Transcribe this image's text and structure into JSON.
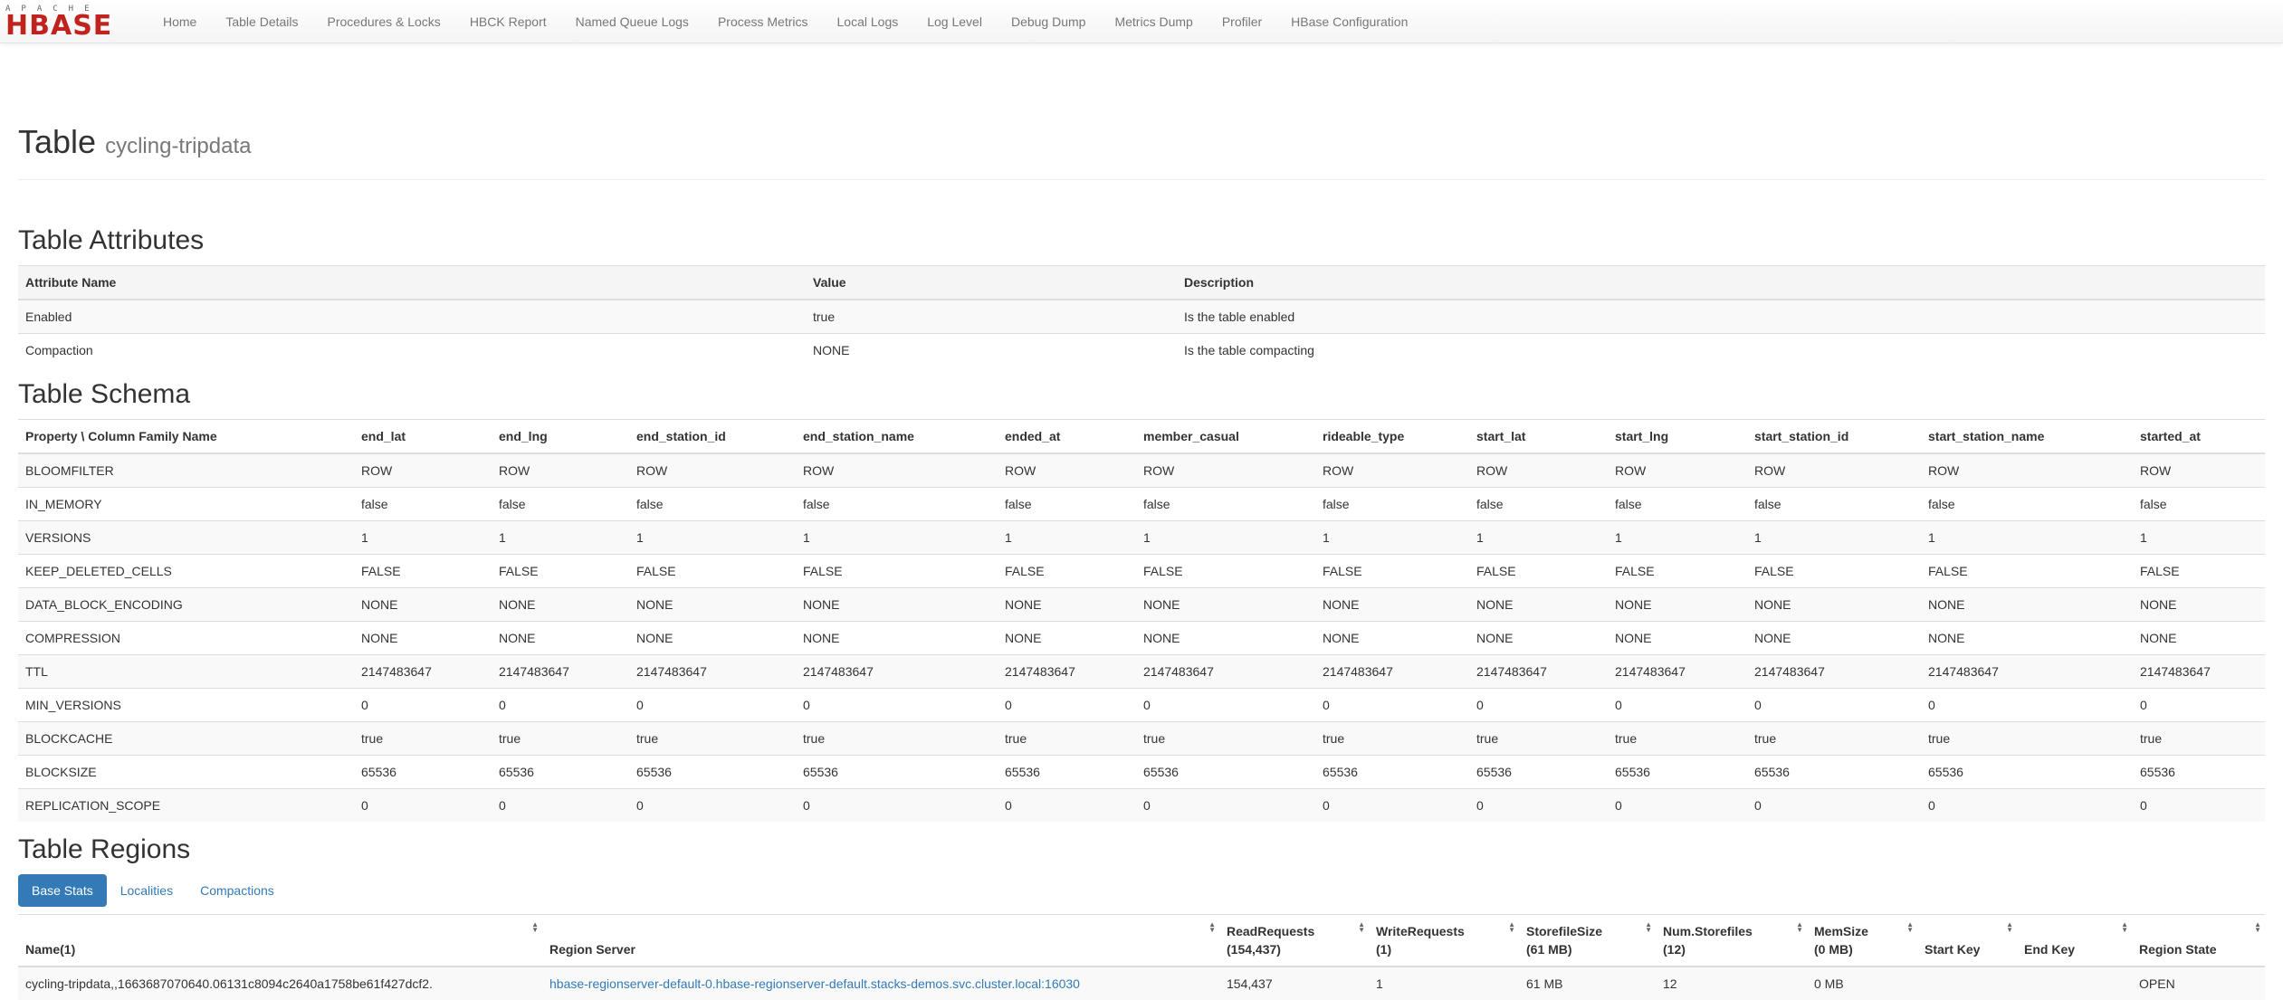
{
  "brand": {
    "top": "APACHE",
    "main": "HBASE",
    "color": "#c0231d"
  },
  "nav": [
    "Home",
    "Table Details",
    "Procedures & Locks",
    "HBCK Report",
    "Named Queue Logs",
    "Process Metrics",
    "Local Logs",
    "Log Level",
    "Debug Dump",
    "Metrics Dump",
    "Profiler",
    "HBase Configuration"
  ],
  "page": {
    "title": "Table",
    "table_name": "cycling-tripdata"
  },
  "attributes": {
    "heading": "Table Attributes",
    "headers": [
      "Attribute Name",
      "Value",
      "Description"
    ],
    "rows": [
      [
        "Enabled",
        "true",
        "Is the table enabled"
      ],
      [
        "Compaction",
        "NONE",
        "Is the table compacting"
      ]
    ]
  },
  "schema": {
    "heading": "Table Schema",
    "headers": [
      "Property \\ Column Family Name",
      "end_lat",
      "end_lng",
      "end_station_id",
      "end_station_name",
      "ended_at",
      "member_casual",
      "rideable_type",
      "start_lat",
      "start_lng",
      "start_station_id",
      "start_station_name",
      "started_at"
    ],
    "rows": [
      [
        "BLOOMFILTER",
        "ROW"
      ],
      [
        "IN_MEMORY",
        "false"
      ],
      [
        "VERSIONS",
        "1"
      ],
      [
        "KEEP_DELETED_CELLS",
        "FALSE"
      ],
      [
        "DATA_BLOCK_ENCODING",
        "NONE"
      ],
      [
        "COMPRESSION",
        "NONE"
      ],
      [
        "TTL",
        "2147483647"
      ],
      [
        "MIN_VERSIONS",
        "0"
      ],
      [
        "BLOCKCACHE",
        "true"
      ],
      [
        "BLOCKSIZE",
        "65536"
      ],
      [
        "REPLICATION_SCOPE",
        "0"
      ]
    ]
  },
  "regions": {
    "heading": "Table Regions",
    "tabs": [
      "Base Stats",
      "Localities",
      "Compactions"
    ],
    "active_tab": "Base Stats",
    "accent": "#337ab7",
    "headers": [
      [
        "Name(1)",
        ""
      ],
      [
        "Region Server",
        ""
      ],
      [
        "ReadRequests",
        "(154,437)"
      ],
      [
        "WriteRequests",
        "(1)"
      ],
      [
        "StorefileSize",
        "(61 MB)"
      ],
      [
        "Num.Storefiles",
        "(12)"
      ],
      [
        "MemSize",
        "(0 MB)"
      ],
      [
        "Start Key",
        ""
      ],
      [
        "End Key",
        ""
      ],
      [
        "Region State",
        ""
      ]
    ],
    "rows": [
      [
        "cycling-tripdata,,1663687070640.06131c8094c2640a1758be61f427dcf2.",
        "hbase-regionserver-default-0.hbase-regionserver-default.stacks-demos.svc.cluster.local:16030",
        "154,437",
        "1",
        "61 MB",
        "12",
        "0 MB",
        "",
        "",
        "OPEN"
      ]
    ]
  }
}
